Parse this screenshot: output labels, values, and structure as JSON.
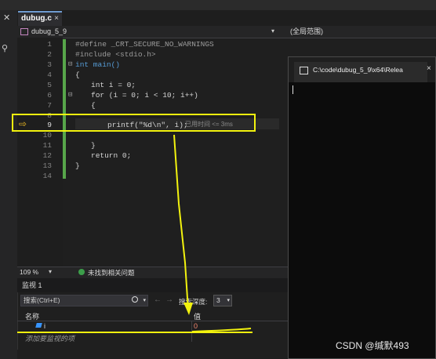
{
  "editor": {
    "tab_label": "dubug.c",
    "tab_close": "×",
    "nav_file": "dubug_5_9",
    "nav_scope": "(全局范围)",
    "lines": [
      {
        "n": "1",
        "text": "#define _CRT_SECURE_NO_WARNINGS"
      },
      {
        "n": "2",
        "text": "#include <stdio.h>"
      },
      {
        "n": "3",
        "text": "int main()"
      },
      {
        "n": "4",
        "text": "{"
      },
      {
        "n": "5",
        "text": "int i = 0;"
      },
      {
        "n": "6",
        "text": "for (i = 0; i < 10; i++)"
      },
      {
        "n": "7",
        "text": "{"
      },
      {
        "n": "8",
        "text": ""
      },
      {
        "n": "9",
        "text": "printf(\"%d\\n\", i);"
      },
      {
        "n": "10",
        "text": ""
      },
      {
        "n": "11",
        "text": "}"
      },
      {
        "n": "12",
        "text": "return 0;"
      },
      {
        "n": "13",
        "text": "}"
      },
      {
        "n": "14",
        "text": ""
      }
    ],
    "elapsed_hint": "已用时间 <= 3ms"
  },
  "console": {
    "title": "C:\\code\\dubug_5_9\\x64\\Relea",
    "close": "×"
  },
  "status": {
    "zoom": "109 %",
    "issues": "未找到相关问题"
  },
  "watch": {
    "title": "监视 1",
    "search_placeholder": "搜索(Ctrl+E)",
    "depth_label": "搜索深度:",
    "depth_value": "3",
    "col_name": "名称",
    "col_value": "值",
    "row_name": "i",
    "row_value": "0",
    "add_item": "添加要监视的项"
  },
  "watermark": "CSDN @缄默493",
  "colors": {
    "highlight": "#f2f20e",
    "changed_value": "#f48771",
    "keyword": "#569cd6"
  },
  "icons": [
    "close-icon",
    "pin-icon",
    "file-icon",
    "execution-arrow-icon",
    "console-window-icon",
    "success-check-icon",
    "search-icon",
    "back-arrow-icon",
    "forward-arrow-icon",
    "variable-icon"
  ]
}
